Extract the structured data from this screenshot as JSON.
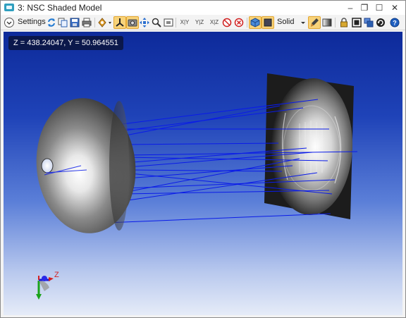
{
  "window": {
    "title": "3: NSC Shaded Model",
    "controls": {
      "minimize": "–",
      "restore": "❐",
      "maximize": "☐",
      "close": "✕"
    }
  },
  "toolbar": {
    "settings_label": "Settings",
    "render_mode_label": "Solid",
    "axis_buttons": [
      "X|Y",
      "Y|Z",
      "X|Z"
    ],
    "active_buttons": [
      "rotate-axes-button",
      "snapshot-view-button",
      "shaded-cube-button",
      "solid-cube-button",
      "brush-tool-button"
    ]
  },
  "viewport": {
    "coordinates": "Z = 438.24047, Y = 50.964551",
    "background_top": "#0d2a9a",
    "background_bottom": "#e6ecf8",
    "ray_color": "#0a1be8",
    "axis_labels": {
      "z": "Z"
    },
    "axis_colors": {
      "x": "#d42020",
      "y": "#1aa31a",
      "z": "#1a1ad4"
    }
  }
}
